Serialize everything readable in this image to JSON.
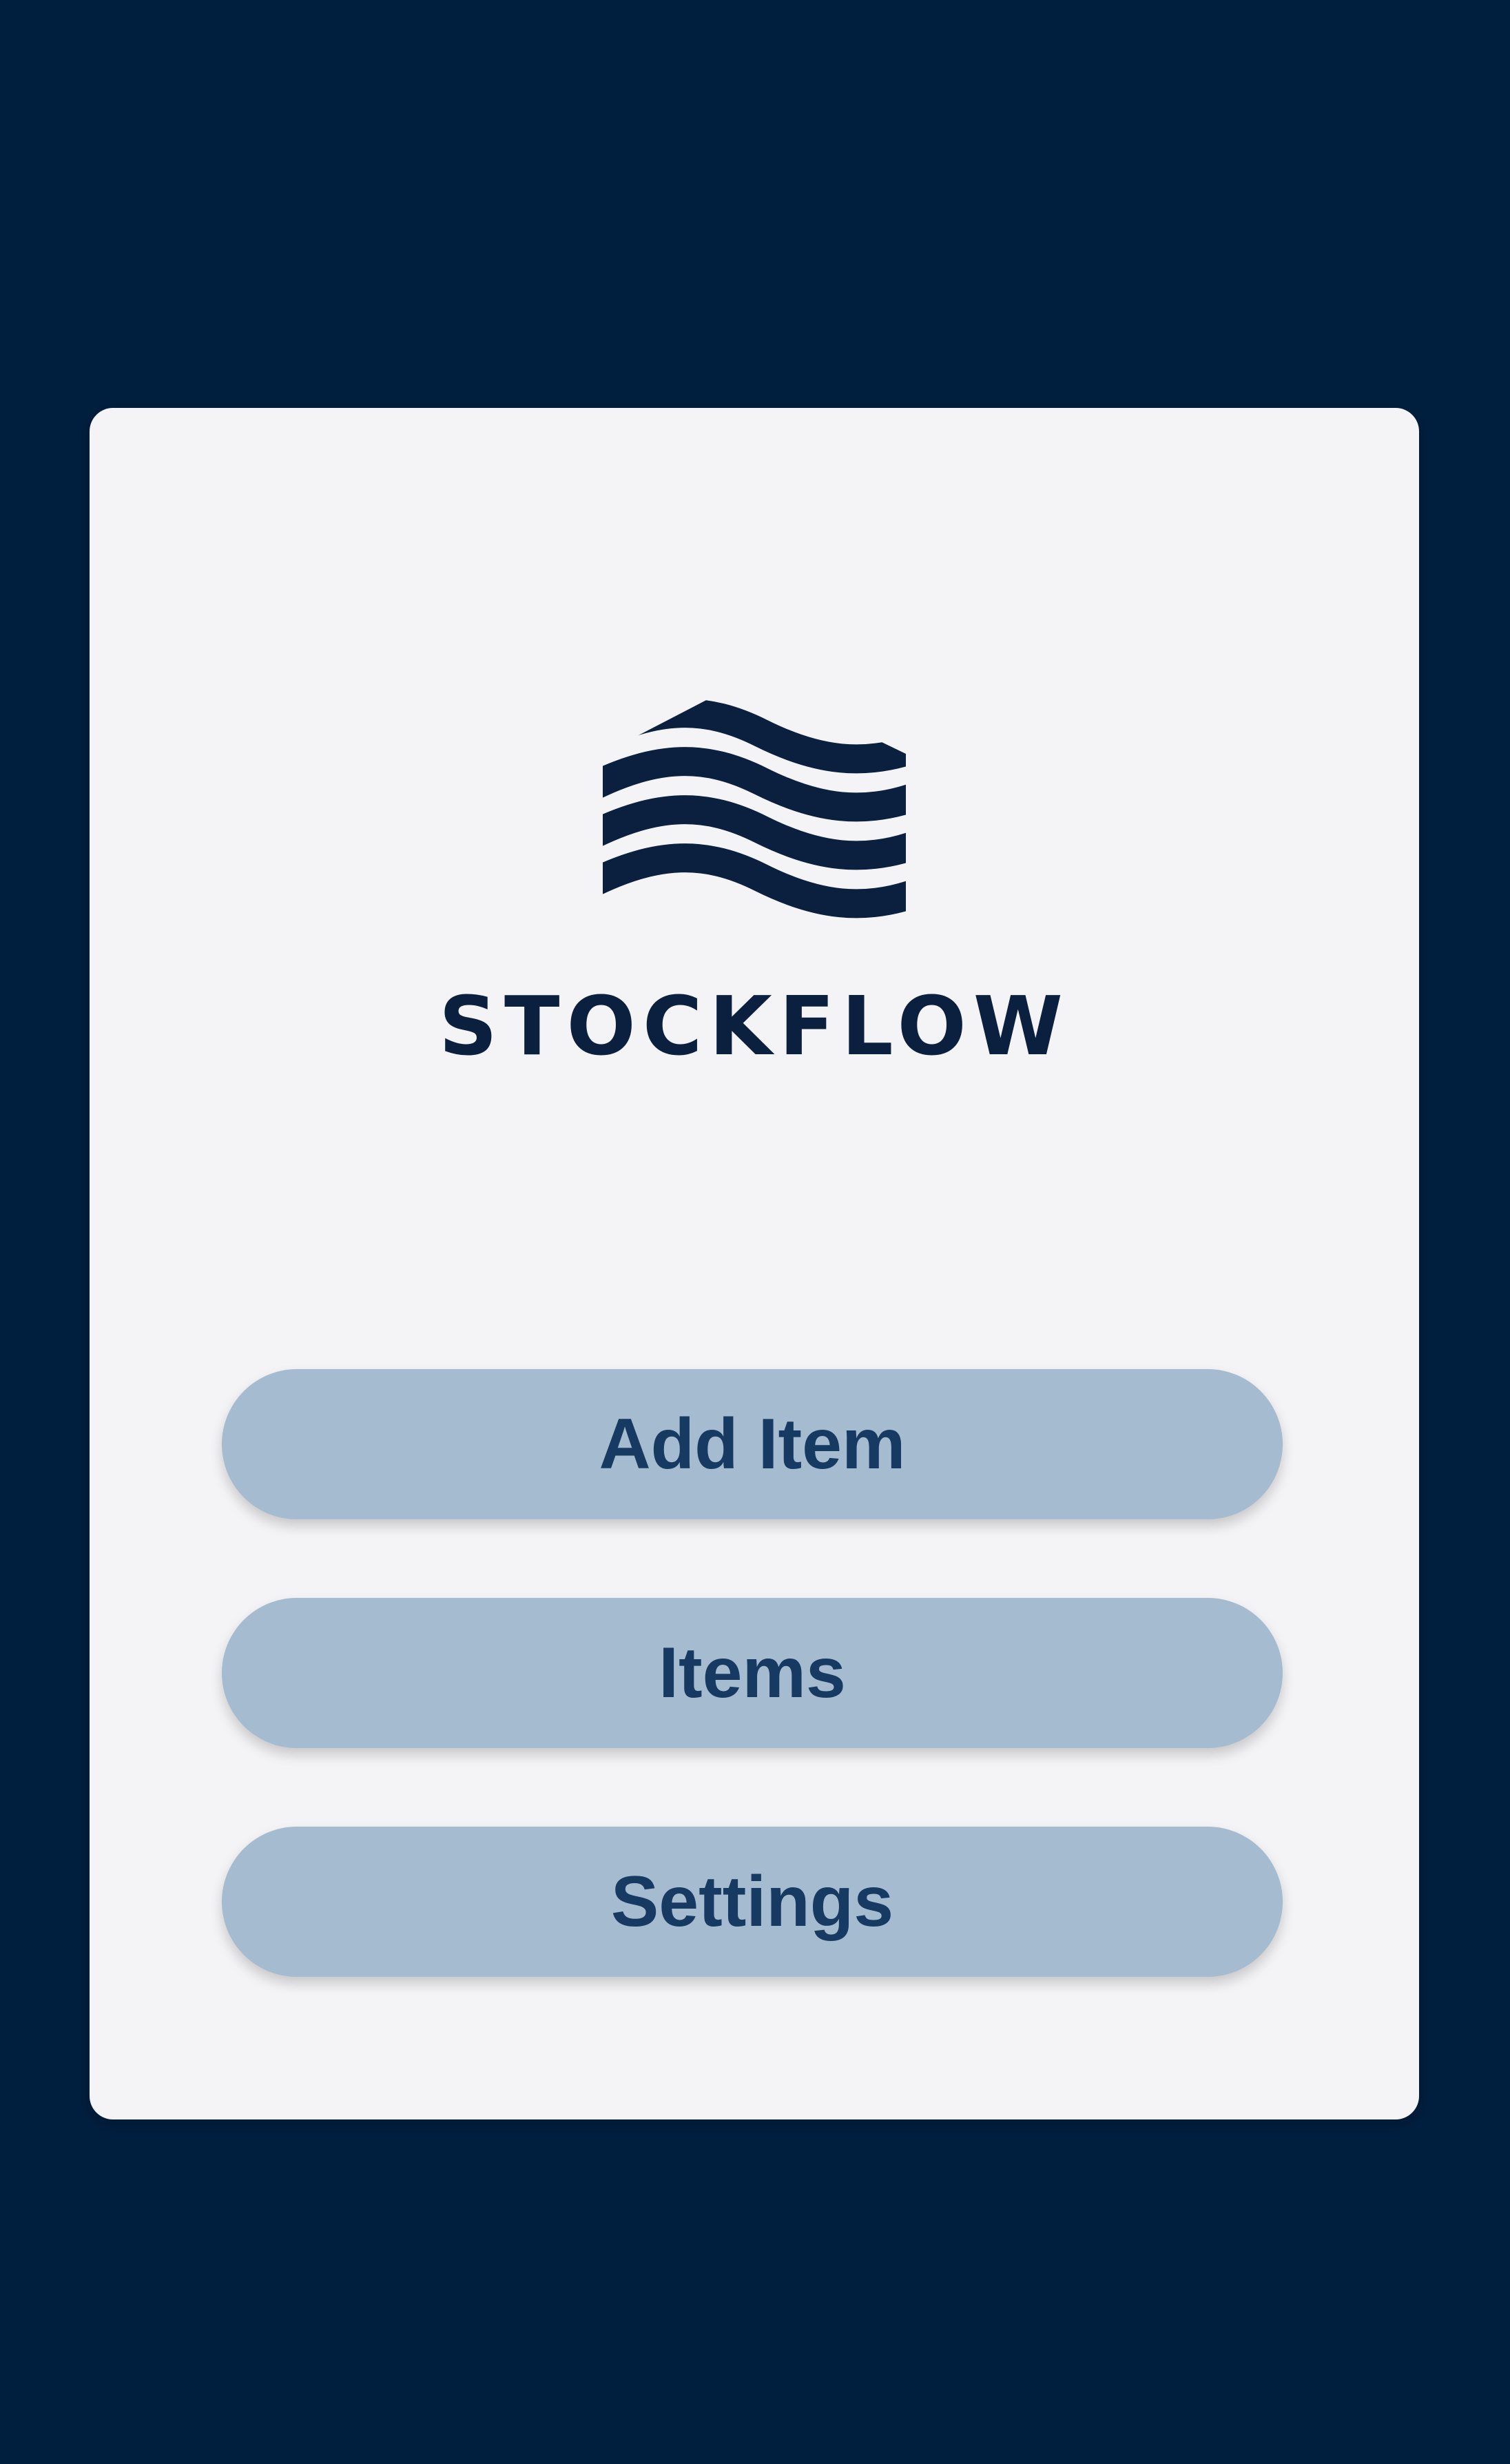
{
  "app": {
    "brand_name": "STOCKFLOW",
    "logo_icon": "warehouse-waves-icon"
  },
  "menu": {
    "items": [
      {
        "label": "Add Item"
      },
      {
        "label": "Items"
      },
      {
        "label": "Settings"
      }
    ]
  },
  "colors": {
    "background": "#001f3f",
    "card": "#f4f4f6",
    "button": "#a5bbd0",
    "button_text": "#163a62",
    "brand": "#0b1f3e"
  }
}
